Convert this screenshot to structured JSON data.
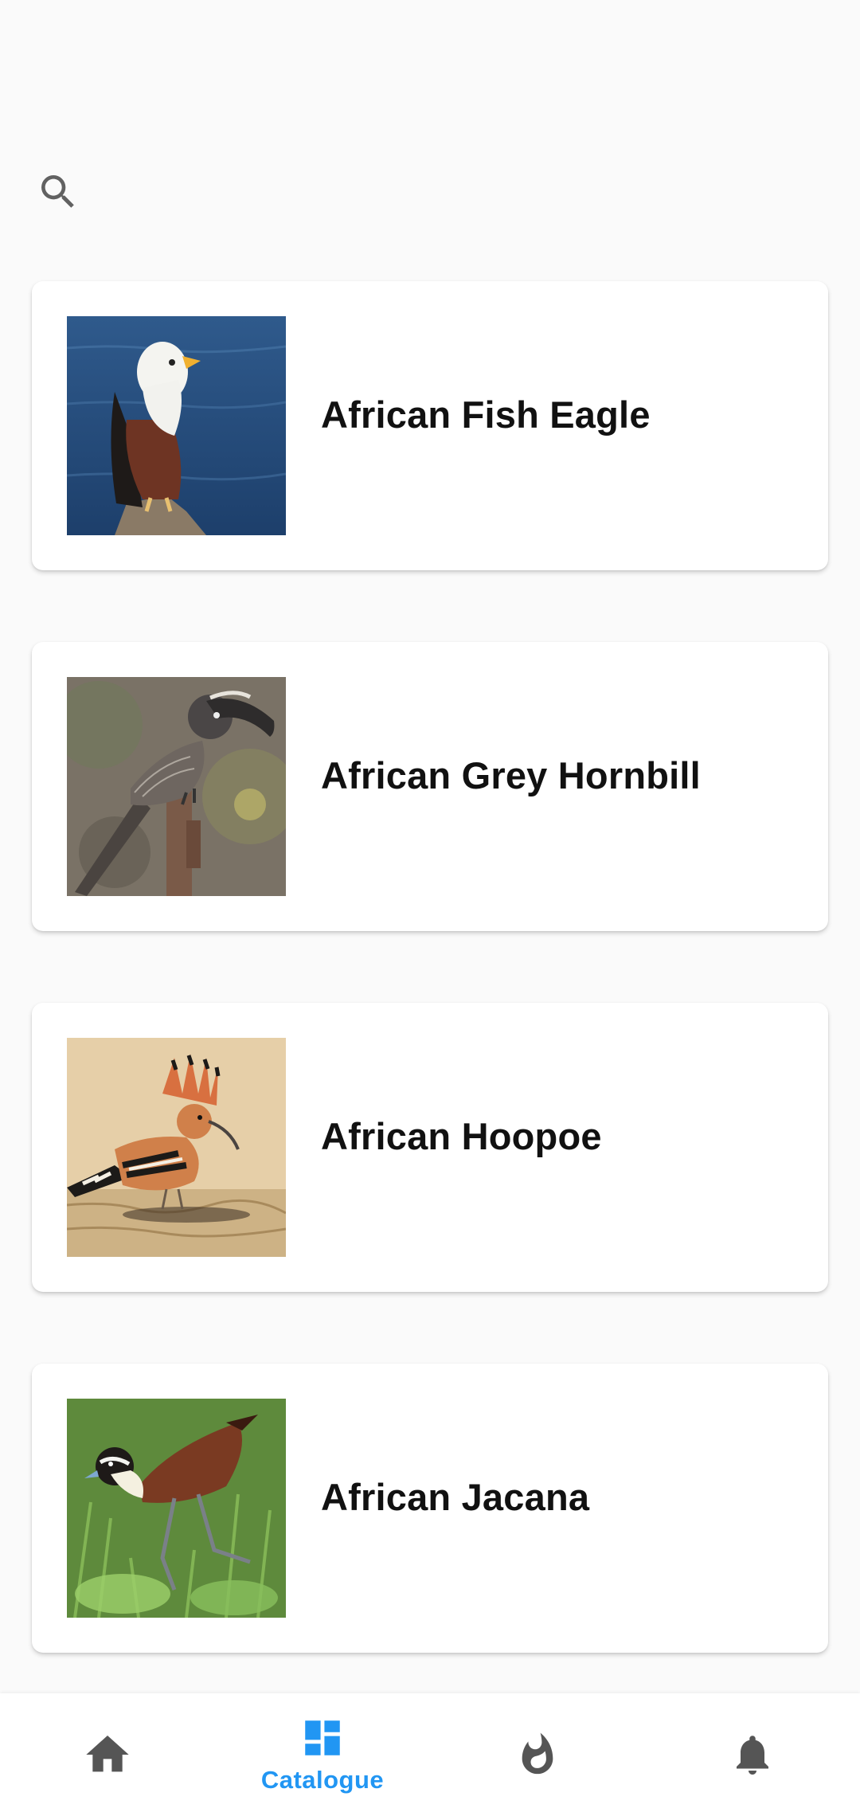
{
  "search": {
    "icon": "search-icon"
  },
  "birds": [
    {
      "name": "African Fish Eagle"
    },
    {
      "name": "African Grey Hornbill"
    },
    {
      "name": "African Hoopoe"
    },
    {
      "name": "African Jacana"
    }
  ],
  "bottom_nav": {
    "active_index": 1,
    "accent": "#2196f3",
    "inactive": "#555555",
    "items": [
      {
        "icon": "home-icon",
        "label": ""
      },
      {
        "icon": "catalogue-icon",
        "label": "Catalogue"
      },
      {
        "icon": "fire-icon",
        "label": ""
      },
      {
        "icon": "bell-icon",
        "label": ""
      }
    ]
  }
}
